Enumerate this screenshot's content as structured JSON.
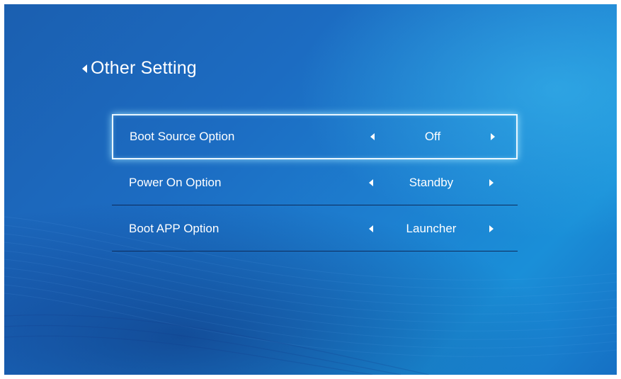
{
  "header": {
    "title": "Other Setting",
    "back_icon": "chevron-left-icon"
  },
  "menu": {
    "items": [
      {
        "label": "Boot Source Option",
        "value": "Off",
        "focused": true
      },
      {
        "label": "Power On Option",
        "value": "Standby",
        "focused": false
      },
      {
        "label": "Boot APP Option",
        "value": "Launcher",
        "focused": false
      }
    ],
    "prev_icon": "caret-left-icon",
    "next_icon": "caret-right-icon"
  },
  "colors": {
    "background_primary": "#1c6cc2",
    "background_highlight": "#3cbef0",
    "focus_border": "#e8f6ff",
    "divider": "#0d2c5c",
    "text": "#ffffff"
  }
}
